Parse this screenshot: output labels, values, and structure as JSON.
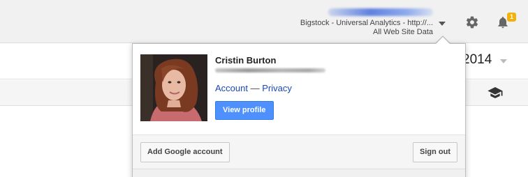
{
  "header": {
    "account_email_redacted": "",
    "property_name": "Bigstock - Universal Analytics - http://...",
    "view_name": "All Web Site Data",
    "notification_count": "1",
    "badge_color": "#f3b10d",
    "icons": [
      "gear-icon",
      "bell-icon",
      "chevron-down-icon"
    ]
  },
  "page": {
    "date_year": "2014",
    "toolbar_icon": "graduation-cap-icon"
  },
  "account_popup": {
    "user_name": "Cristin Burton",
    "user_email_redacted": "",
    "account_link": "Account",
    "separator": "—",
    "privacy_link": "Privacy",
    "view_profile_button": "View profile",
    "add_account_button": "Add Google account",
    "sign_out_button": "Sign out",
    "accent_color": "#4d90fe",
    "link_color": "#1a47b8"
  }
}
